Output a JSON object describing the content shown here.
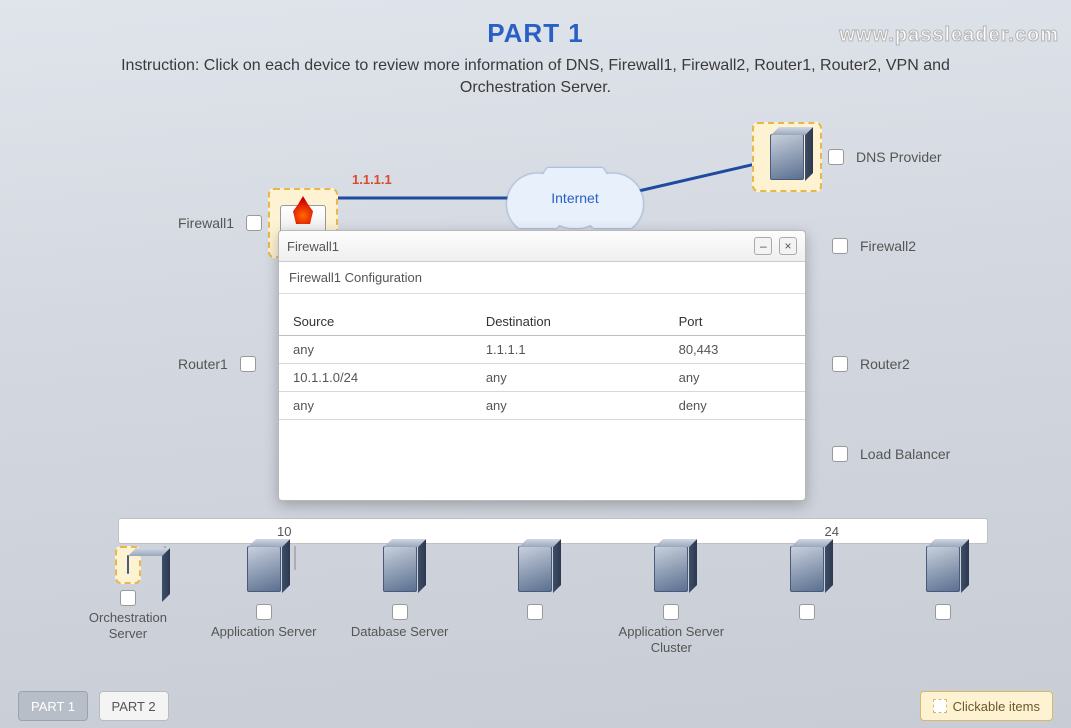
{
  "watermark": "www.passleader.com",
  "header": {
    "title": "PART 1",
    "instruction": "Instruction: Click on each device to review more information of DNS, Firewall1, Firewall2, Router1, Router2, VPN and Orchestration Server."
  },
  "nodes": {
    "firewall1": {
      "label": "Firewall1",
      "ip": "1.1.1.1"
    },
    "firewall2": {
      "label": "Firewall2"
    },
    "dns": {
      "label": "DNS Provider"
    },
    "internet": {
      "label": "Internet"
    },
    "router1": {
      "label": "Router1"
    },
    "router2": {
      "label": "Router2"
    },
    "loadbalancer": {
      "label": "Load Balancer"
    }
  },
  "subnet_bar": {
    "left_fragment": "10",
    "right_fragment": "24"
  },
  "bottom": {
    "items": [
      {
        "label": "Orchestration Server"
      },
      {
        "label": "Application Server"
      },
      {
        "label": "Database Server"
      },
      {
        "label": ""
      },
      {
        "label": ""
      },
      {
        "label": ""
      },
      {
        "label": ""
      }
    ],
    "cluster_label": "Application Server Cluster"
  },
  "dialog": {
    "title": "Firewall1",
    "subtitle": "Firewall1 Configuration",
    "columns": [
      "Source",
      "Destination",
      "Port"
    ],
    "rows": [
      [
        "any",
        "1.1.1.1",
        "80,443"
      ],
      [
        "10.1.1.0/24",
        "any",
        "any"
      ],
      [
        "any",
        "any",
        "deny"
      ]
    ]
  },
  "footer": {
    "part1": "PART 1",
    "part2": "PART 2",
    "clickable": "Clickable items"
  }
}
